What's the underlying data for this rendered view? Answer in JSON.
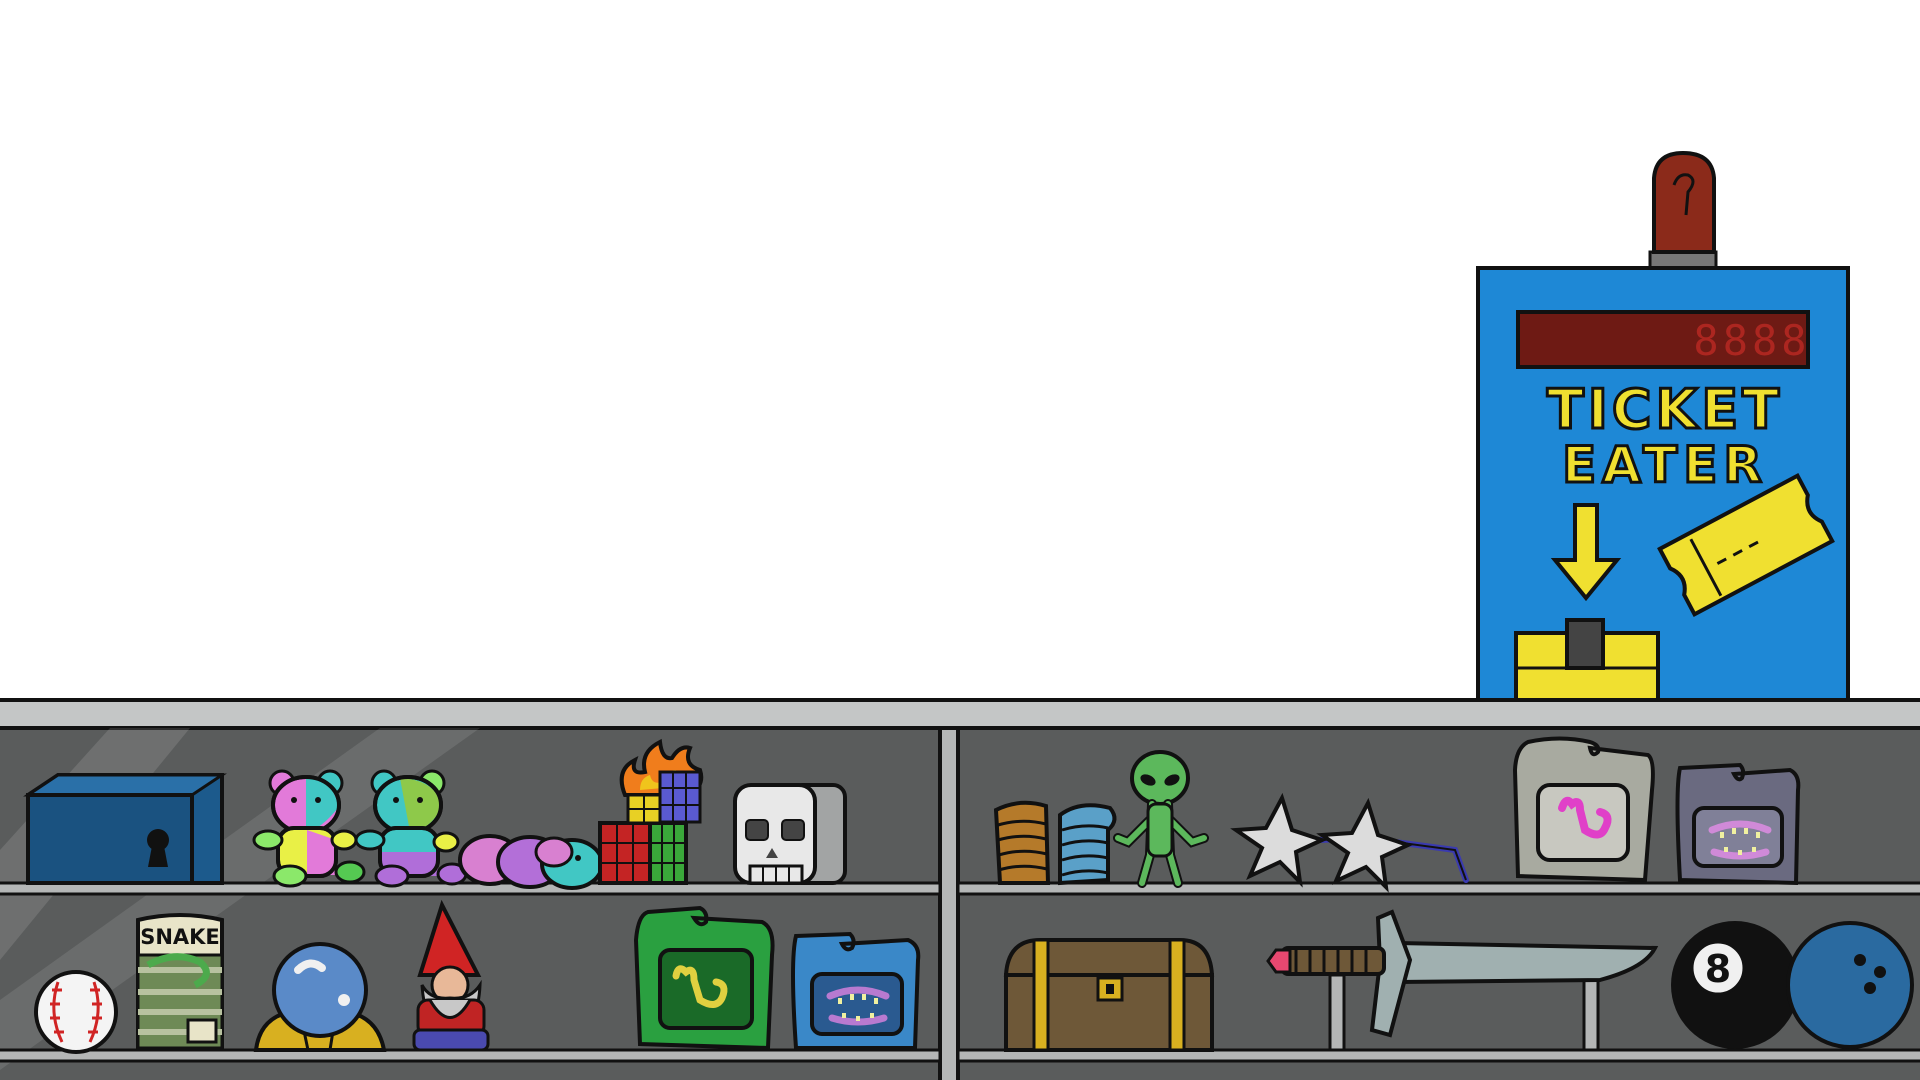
{
  "machine": {
    "name": "ticket-eater",
    "title_line1": "TICKET",
    "title_line2": "EATER",
    "display_value": "8888",
    "body_color": "#1e88d6",
    "text_color": "#f0e030",
    "display_color": "#6e1a14",
    "display_digit_color": "#e0302a"
  },
  "counter": {
    "top_color": "#c4c6c6",
    "case_color": "#5a5c5c",
    "shelf_color": "#b4b6b6"
  },
  "prizes": {
    "shelf_top_left": [
      "blue-lockbox",
      "rainbow-teddy-bear-1",
      "rainbow-teddy-bear-2",
      "striped-plush-caterpillar",
      "flaming-rubiks-cube",
      "skull-block"
    ],
    "shelf_top_right": [
      "slinky-toy-gold",
      "slinky-toy-blue",
      "green-alien-figure",
      "ninja-throwing-stars-sunglasses",
      "gray-gummy-pack",
      "purple-gummy-teeth-pack"
    ],
    "shelf_bottom_left": [
      "baseball",
      "canned-snake-prank",
      "crystal-ball",
      "garden-gnome",
      "green-gummy-lizard-pack",
      "blue-gummy-teeth-pack"
    ],
    "shelf_bottom_right": [
      "treasure-chest",
      "sword-on-stand",
      "eight-ball",
      "bowling-ball"
    ]
  },
  "labels": {
    "snake_can": "SNAKE",
    "eight_ball": "8"
  }
}
